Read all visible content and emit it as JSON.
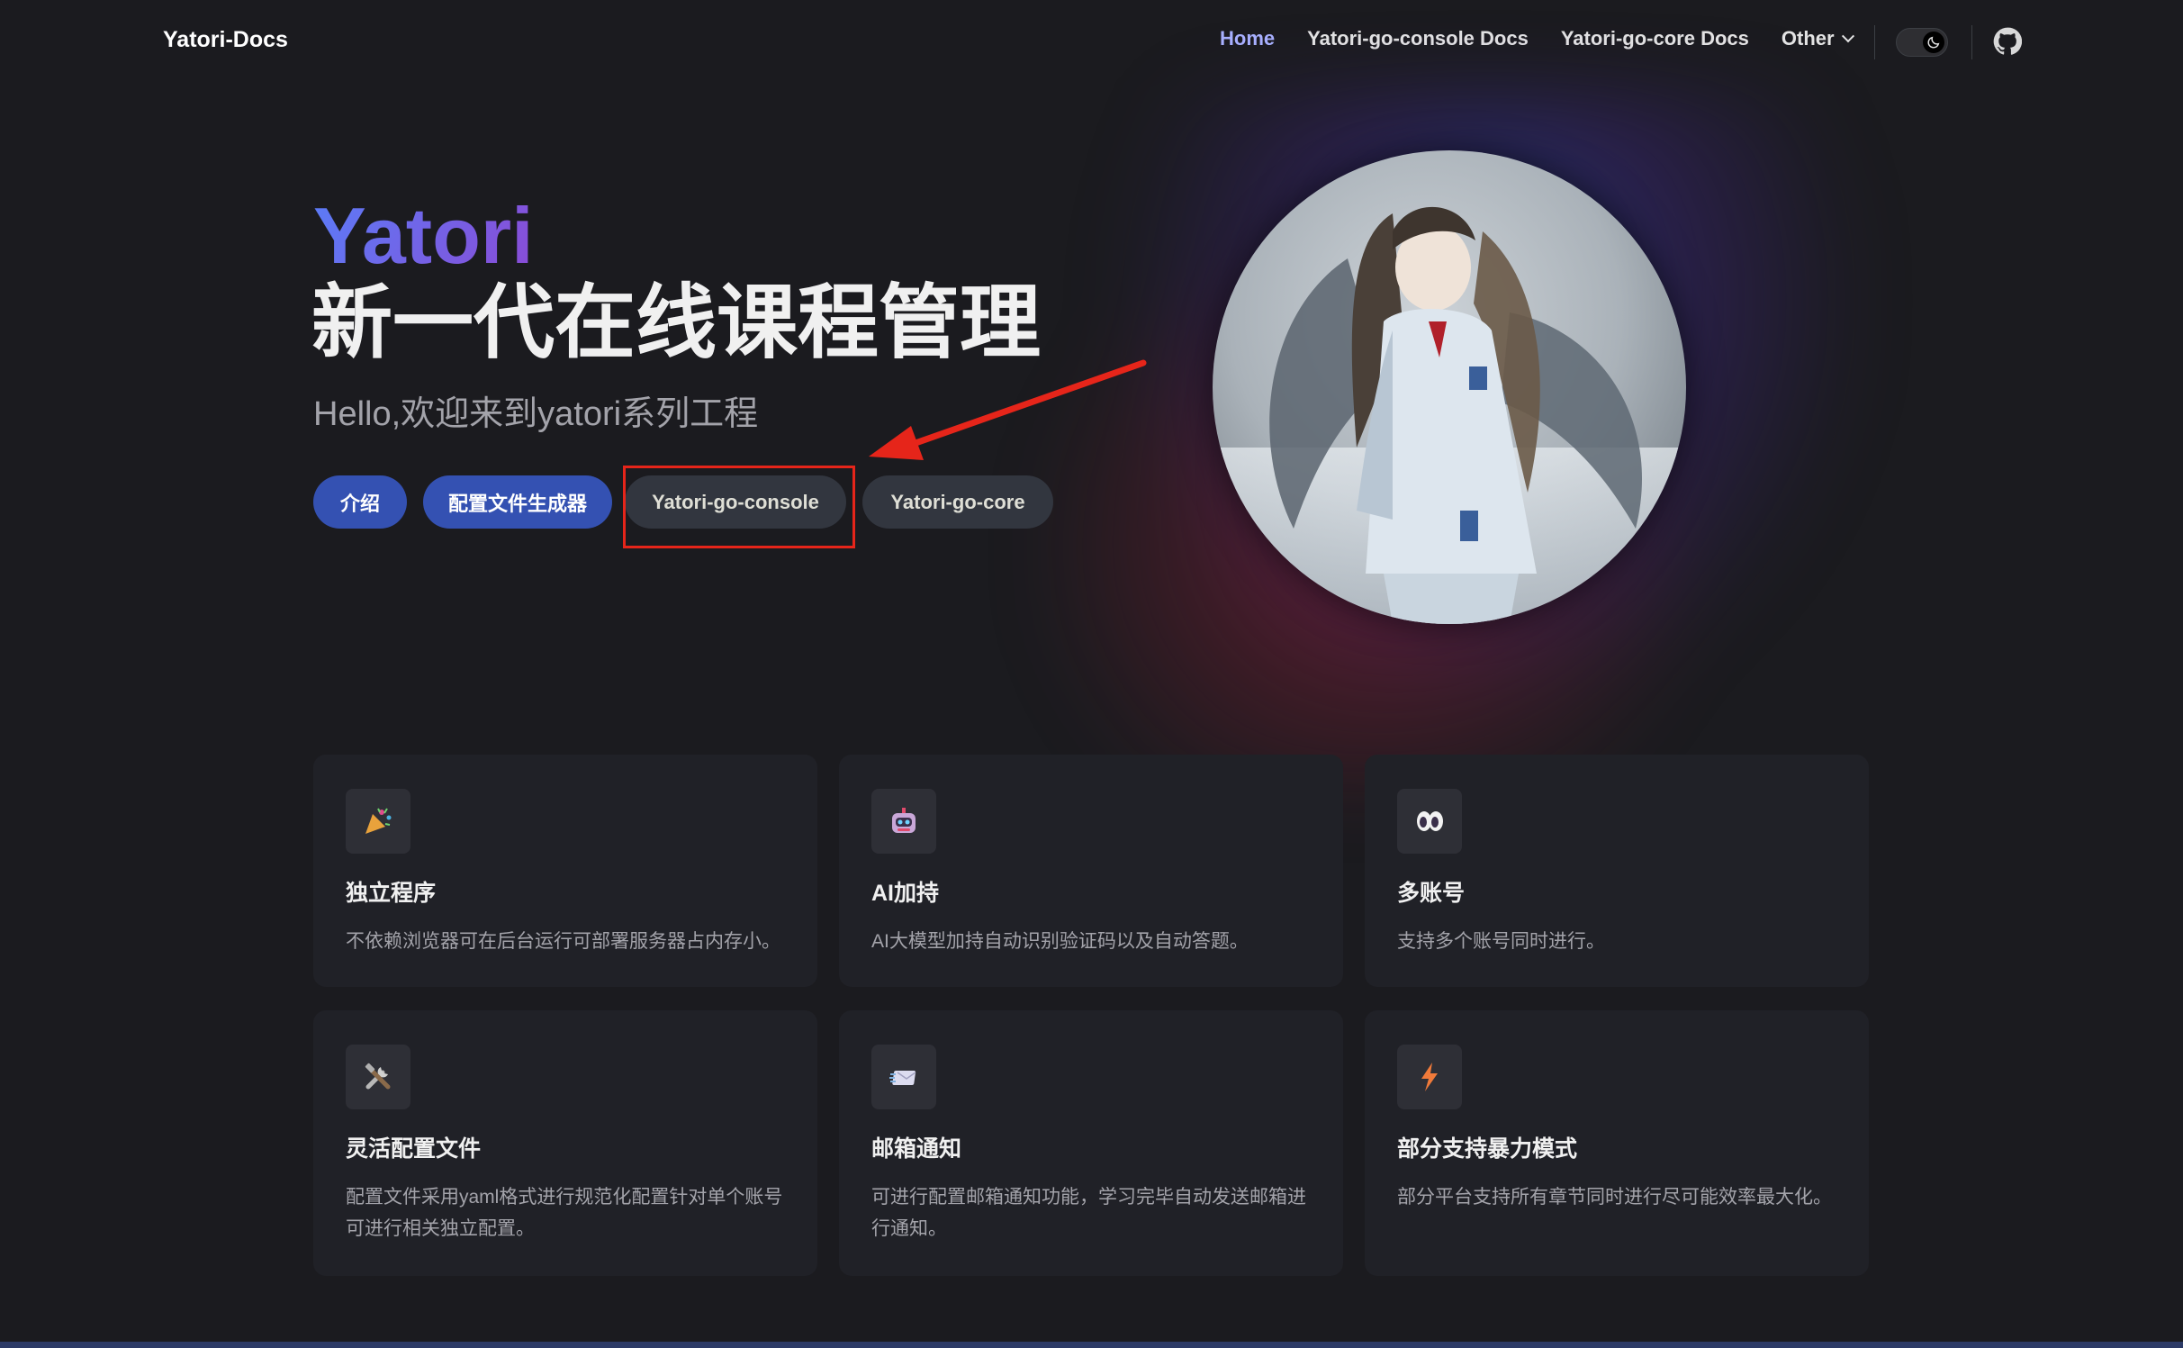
{
  "nav": {
    "site_title": "Yatori-Docs",
    "links": [
      "Home",
      "Yatori-go-console Docs",
      "Yatori-go-core Docs"
    ],
    "other_label": "Other",
    "active": "Home"
  },
  "hero": {
    "name": "Yatori",
    "text": "新一代在线课程管理",
    "tagline": "Hello,欢迎来到yatori系列工程",
    "actions": [
      "介绍",
      "配置文件生成器",
      "Yatori-go-console",
      "Yatori-go-core"
    ]
  },
  "features": [
    {
      "icon": "party-popper-icon",
      "title": "独立程序",
      "desc": "不依赖浏览器可在后台运行可部署服务器占内存小。"
    },
    {
      "icon": "robot-icon",
      "title": "AI加持",
      "desc": "AI大模型加持自动识别验证码以及自动答题。"
    },
    {
      "icon": "eyes-icon",
      "title": "多账号",
      "desc": "支持多个账号同时进行。"
    },
    {
      "icon": "tools-icon",
      "title": "灵活配置文件",
      "desc": "配置文件采用yaml格式进行规范化配置针对单个账号可进行相关独立配置。"
    },
    {
      "icon": "email-icon",
      "title": "邮箱通知",
      "desc": "可进行配置邮箱通知功能，学习完毕自动发送邮箱进行通知。"
    },
    {
      "icon": "lightning-icon",
      "title": "部分支持暴力模式",
      "desc": "部分平台支持所有章节同时进行尽可能效率最大化。"
    }
  ],
  "colors": {
    "brand": "#3451b2",
    "highlight": "#e6251a",
    "active_link": "#a8b1ff"
  }
}
